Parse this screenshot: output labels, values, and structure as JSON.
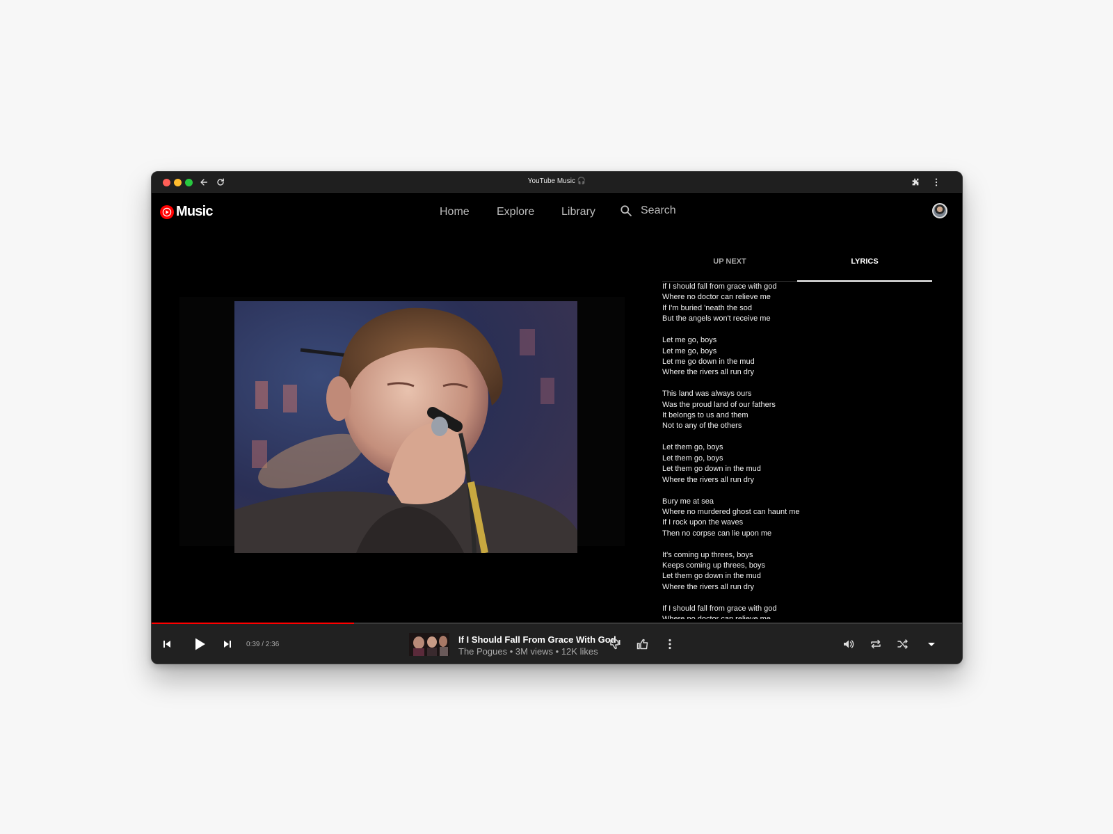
{
  "window": {
    "title": "YouTube Music 🎧"
  },
  "topnav": {
    "logo_text": "Music",
    "items": [
      {
        "label": "Home"
      },
      {
        "label": "Explore"
      },
      {
        "label": "Library"
      }
    ],
    "search_label": "Search"
  },
  "side_panel": {
    "tabs": [
      {
        "label": "UP NEXT",
        "active": false
      },
      {
        "label": "LYRICS",
        "active": true
      }
    ],
    "lyrics": [
      [
        "If I should fall from grace with god",
        "Where no doctor can relieve me",
        "If I'm buried 'neath the sod",
        "But the angels won't receive me"
      ],
      [
        "Let me go, boys",
        "Let me go, boys",
        "Let me go down in the mud",
        "Where the rivers all run dry"
      ],
      [
        "This land was always ours",
        "Was the proud land of our fathers",
        "It belongs to us and them",
        "Not to any of the others"
      ],
      [
        "Let them go, boys",
        "Let them go, boys",
        "Let them go down in the mud",
        "Where the rivers all run dry"
      ],
      [
        "Bury me at sea",
        "Where no murdered ghost can haunt me",
        "If I rock upon the waves",
        "Then no corpse can lie upon me"
      ],
      [
        "It's coming up threes, boys",
        "Keeps coming up threes, boys",
        "Let them go down in the mud",
        "Where the rivers all run dry"
      ],
      [
        "If I should fall from grace with god",
        "Where no doctor can relieve me"
      ]
    ]
  },
  "player": {
    "time": "0:39 / 2:36",
    "progress": 0.25,
    "song_title": "If I Should Fall From Grace With God",
    "song_meta": "The Pogues • 3M views • 12K likes",
    "accent_color": "#ff0000",
    "icons": [
      "previous-icon",
      "play-icon",
      "next-icon",
      "thumbs-down-icon",
      "thumbs-up-icon",
      "more-icon",
      "volume-icon",
      "repeat-icon",
      "shuffle-icon",
      "expand-icon"
    ]
  }
}
